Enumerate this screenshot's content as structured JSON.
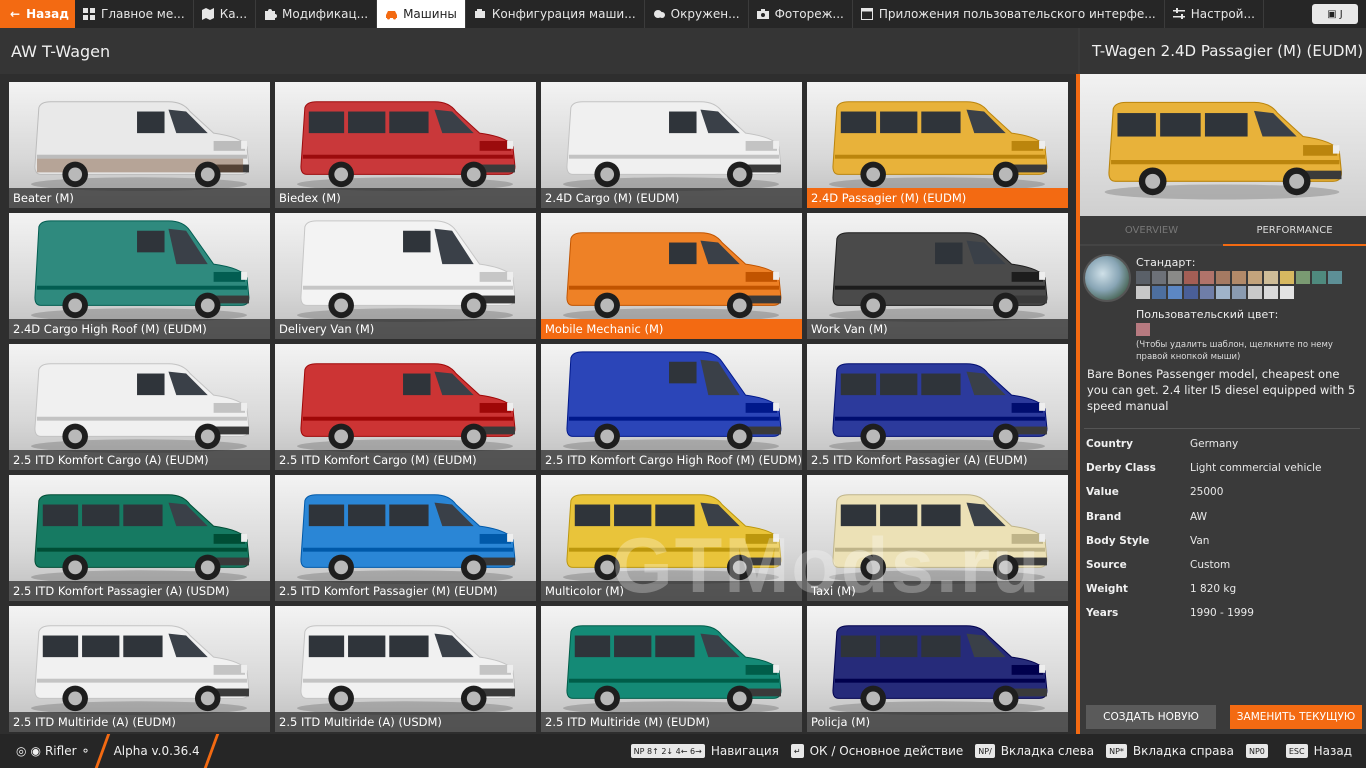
{
  "topbar": {
    "back_label": "Назад",
    "tabs": [
      {
        "label": "Главное ме...",
        "icon": "grid-icon"
      },
      {
        "label": "Ка...",
        "icon": "map-icon"
      },
      {
        "label": "Модификац...",
        "icon": "puzzle-icon"
      },
      {
        "label": "Машины",
        "icon": "car-icon",
        "active": true
      },
      {
        "label": "Конфигурация маши...",
        "icon": "engine-icon"
      },
      {
        "label": "Окружен...",
        "icon": "weather-icon"
      },
      {
        "label": "Фотореж...",
        "icon": "camera-icon"
      },
      {
        "label": "Приложения пользовательского интерфе...",
        "icon": "ui-apps-icon"
      },
      {
        "label": "Настрой...",
        "icon": "sliders-icon"
      }
    ],
    "right_badge": "J"
  },
  "left": {
    "title": "AW T-Wagen",
    "tiles": [
      {
        "label": "Beater (M)",
        "color": "#e9e9e9",
        "style": "cargo",
        "rust": true
      },
      {
        "label": "Biedex (M)",
        "color": "#c9383a",
        "style": "bus"
      },
      {
        "label": "2.4D Cargo (M) (EUDM)",
        "color": "#f0f0f0",
        "style": "cargo"
      },
      {
        "label": "2.4D Passagier (M) (EUDM)",
        "color": "#e8b23a",
        "style": "bus",
        "selected": true
      },
      {
        "label": "2.4D Cargo High Roof (M) (EUDM)",
        "color": "#2f8a7e",
        "style": "high"
      },
      {
        "label": "Delivery Van (M)",
        "color": "#f3f3f3",
        "style": "high"
      },
      {
        "label": "Mobile Mechanic (M)",
        "color": "#ee8126",
        "style": "cargo",
        "highlight": true
      },
      {
        "label": "Work Van (M)",
        "color": "#4a4a4a",
        "style": "cargo"
      },
      {
        "label": "2.5 ITD Komfort Cargo (A) (EUDM)",
        "color": "#f0f0f0",
        "style": "cargo"
      },
      {
        "label": "2.5 ITD Komfort Cargo (M) (EUDM)",
        "color": "#cc3434",
        "style": "cargo"
      },
      {
        "label": "2.5 ITD Komfort Cargo High Roof (M) (EUDM)",
        "color": "#2b45b8",
        "style": "high"
      },
      {
        "label": "2.5 ITD Komfort Passagier (A) (EUDM)",
        "color": "#2c3a9c",
        "style": "bus"
      },
      {
        "label": "2.5 ITD Komfort Passagier (A) (USDM)",
        "color": "#167a62",
        "style": "bus"
      },
      {
        "label": "2.5 ITD Komfort Passagier (M) (EUDM)",
        "color": "#2a86d6",
        "style": "bus"
      },
      {
        "label": "Multicolor (M)",
        "color": "#e9c43a",
        "style": "bus"
      },
      {
        "label": "Taxi (M)",
        "color": "#ece1b6",
        "style": "bus"
      },
      {
        "label": "2.5 ITD Multiride (A) (EUDM)",
        "color": "#f1f1f1",
        "style": "bus"
      },
      {
        "label": "2.5 ITD Multiride (A) (USDM)",
        "color": "#f1f1f1",
        "style": "bus"
      },
      {
        "label": "2.5 ITD Multiride (M) (EUDM)",
        "color": "#148a76",
        "style": "bus"
      },
      {
        "label": "Policja (M)",
        "color": "#262b7a",
        "style": "bus"
      }
    ]
  },
  "watermark": "GTMods.ru",
  "right": {
    "title": "T-Wagen 2.4D Passagier (M) (EUDM)",
    "preview_color": "#e8b23a",
    "tabs": [
      "Overview",
      "Performance"
    ],
    "standard_label": "Стандарт:",
    "swatches": [
      "#5a6068",
      "#6d7178",
      "#8a8a88",
      "#a35e55",
      "#b0736a",
      "#a57a62",
      "#b28a69",
      "#c4a47c",
      "#cfbd98",
      "#d7b860",
      "#7a9a72",
      "#4f8a7e",
      "#5d8f96",
      "#c8c8c8",
      "#4d6f9f",
      "#5c87c4",
      "#4a5f98",
      "#6f7ea8",
      "#9fb3c9",
      "#8a9bb0",
      "#c9c9c9",
      "#d9d9d9",
      "#e3e3e3"
    ],
    "custom_label": "Пользовательский цвет:",
    "custom_color": "#b77a80",
    "hint": "(Чтобы удалить шаблон, щелкните по нему правой кнопкой мыши)",
    "description": "Bare Bones Passenger model, cheapest one you can get. 2.4 liter I5 diesel equipped with 5 speed manual",
    "info": [
      {
        "k": "Country",
        "v": "Germany"
      },
      {
        "k": "Derby Class",
        "v": "Light commercial vehicle"
      },
      {
        "k": "Value",
        "v": "25000"
      },
      {
        "k": "Brand",
        "v": "AW"
      },
      {
        "k": "Body Style",
        "v": "Van"
      },
      {
        "k": "Source",
        "v": "Custom"
      },
      {
        "k": "Weight",
        "v": "1 820 kg"
      },
      {
        "k": "Years",
        "v": "1990 - 1999"
      }
    ],
    "btn_new": "Создать новую",
    "btn_replace": "Заменить текущую"
  },
  "bottom": {
    "user": "Rifler",
    "version": "Alpha v.0.36.4",
    "hints": [
      {
        "keys": "NP 8↑ 2↓ 4← 6→",
        "label": "Навигация"
      },
      {
        "keys": "↵",
        "label": "ОК / Основное действие"
      },
      {
        "keys": "NP/",
        "label": "Вкладка слева"
      },
      {
        "keys": "NP*",
        "label": "Вкладка справа"
      },
      {
        "keys": "NP0",
        "label": ""
      },
      {
        "keys": "ESC",
        "label": "Назад"
      }
    ]
  }
}
